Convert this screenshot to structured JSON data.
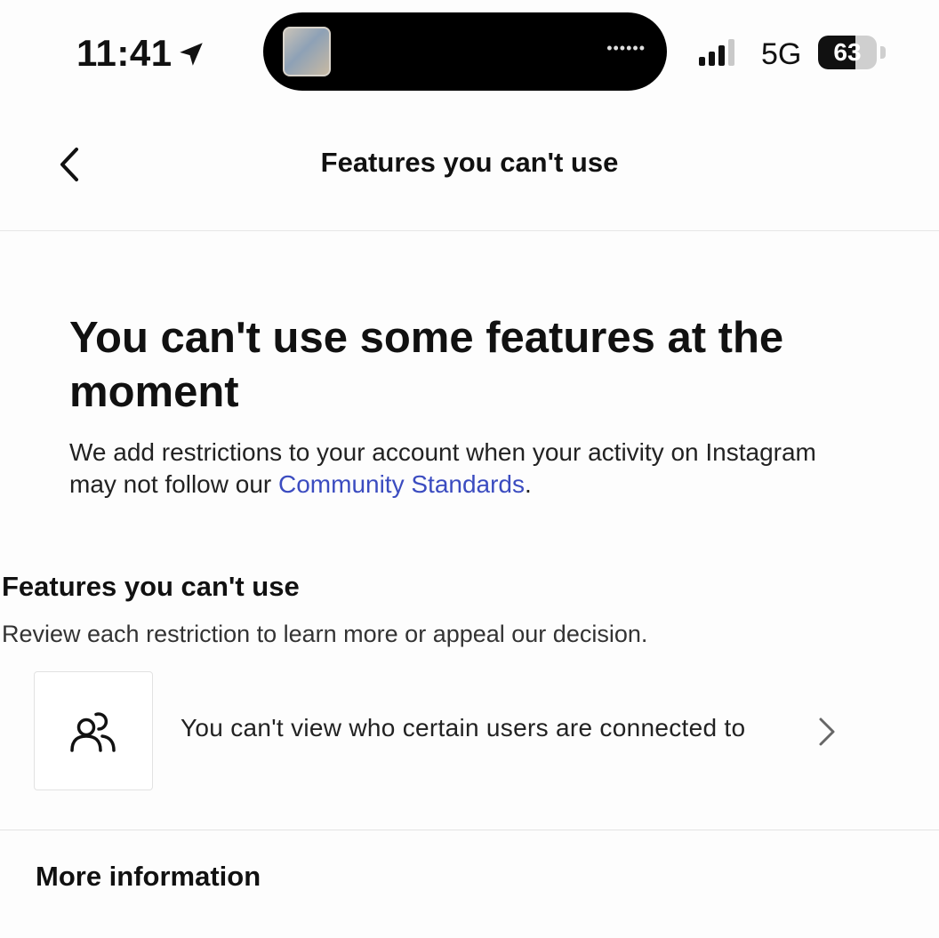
{
  "status_bar": {
    "time": "11:41",
    "network": "5G",
    "battery_level": "63",
    "location_icon": "location-arrow-icon",
    "signal_icon": "cellular-signal-icon"
  },
  "header": {
    "title": "Features you can't use",
    "back_icon": "chevron-left-icon"
  },
  "hero": {
    "title": "You can't use some features at the moment",
    "description_prefix": "We add restrictions to your account when your activity on Instagram may not follow our ",
    "description_link": "Community Standards",
    "description_suffix": "."
  },
  "features_section": {
    "title": "Features you can't use",
    "subtitle": "Review each restriction to learn more or appeal our decision.",
    "items": [
      {
        "label": "You can't view who certain users are connected to",
        "icon": "users-icon",
        "chevron_icon": "chevron-right-icon"
      }
    ]
  },
  "more_info": {
    "title": "More information"
  },
  "colors": {
    "link": "#3b4cc0",
    "text": "#111111",
    "background": "#fdfdfd"
  }
}
